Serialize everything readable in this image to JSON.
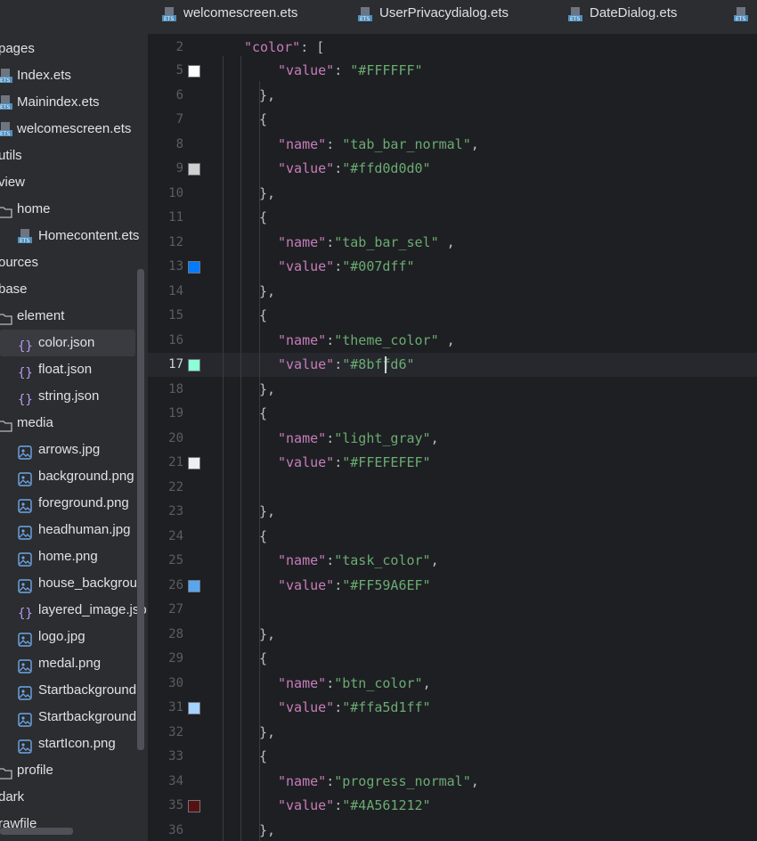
{
  "tabs": [
    {
      "label": "welcomescreen.ets"
    },
    {
      "label": "UserPrivacydialog.ets"
    },
    {
      "label": "DateDialog.ets"
    },
    {
      "label": ""
    }
  ],
  "tree": [
    {
      "label": "pages",
      "icon": "none",
      "indent": 0
    },
    {
      "label": "Index.ets",
      "icon": "ets-file-icon",
      "indent": 0
    },
    {
      "label": "Mainindex.ets",
      "icon": "ets-file-icon",
      "indent": 0
    },
    {
      "label": "welcomescreen.ets",
      "icon": "ets-file-icon",
      "indent": 0
    },
    {
      "label": "utils",
      "icon": "none",
      "indent": 0
    },
    {
      "label": "view",
      "icon": "none",
      "indent": 0
    },
    {
      "label": "home",
      "icon": "folder-icon",
      "indent": 0
    },
    {
      "label": "Homecontent.ets",
      "icon": "ets-file-icon",
      "indent": 1
    },
    {
      "label": "ources",
      "icon": "none",
      "indent": 0
    },
    {
      "label": "base",
      "icon": "none",
      "indent": 0
    },
    {
      "label": "element",
      "icon": "folder-icon",
      "indent": 0
    },
    {
      "label": "color.json",
      "icon": "json-icon",
      "indent": 1,
      "selected": true
    },
    {
      "label": "float.json",
      "icon": "json-icon",
      "indent": 1
    },
    {
      "label": "string.json",
      "icon": "json-icon",
      "indent": 1
    },
    {
      "label": "media",
      "icon": "folder-icon",
      "indent": 0
    },
    {
      "label": "arrows.jpg",
      "icon": "image-icon",
      "indent": 1
    },
    {
      "label": "background.png",
      "icon": "image-icon",
      "indent": 1
    },
    {
      "label": "foreground.png",
      "icon": "image-icon",
      "indent": 1
    },
    {
      "label": "headhuman.jpg",
      "icon": "image-icon",
      "indent": 1
    },
    {
      "label": "home.png",
      "icon": "image-icon",
      "indent": 1
    },
    {
      "label": "house_backgroun",
      "icon": "image-icon",
      "indent": 1
    },
    {
      "label": "layered_image.jso",
      "icon": "json-icon",
      "indent": 1
    },
    {
      "label": "logo.jpg",
      "icon": "image-icon",
      "indent": 1
    },
    {
      "label": "medal.png",
      "icon": "image-icon",
      "indent": 1
    },
    {
      "label": "Startbackground",
      "icon": "image-icon",
      "indent": 1
    },
    {
      "label": "Startbackground",
      "icon": "image-icon",
      "indent": 1
    },
    {
      "label": "startIcon.png",
      "icon": "image-icon",
      "indent": 1
    },
    {
      "label": "profile",
      "icon": "folder-icon",
      "indent": 0
    },
    {
      "label": "dark",
      "icon": "none",
      "indent": 0
    },
    {
      "label": "rawfile",
      "icon": "none",
      "indent": 0
    }
  ],
  "editor": {
    "current_line": "17",
    "lines": [
      {
        "n": "2",
        "text": "\"color\": [",
        "swatch": null,
        "indent": 0
      },
      {
        "n": "5",
        "text": "\"value\": \"#FFFFFF\"",
        "swatch": "#FFFFFF",
        "indent": 2
      },
      {
        "n": "6",
        "text": "},",
        "swatch": null,
        "indent": 1
      },
      {
        "n": "7",
        "text": "{",
        "swatch": null,
        "indent": 1
      },
      {
        "n": "8",
        "text": "\"name\": \"tab_bar_normal\",",
        "swatch": null,
        "indent": 2
      },
      {
        "n": "9",
        "text": "\"value\":\"#ffd0d0d0\"",
        "swatch": "#d0d0d0",
        "indent": 2
      },
      {
        "n": "10",
        "text": "},",
        "swatch": null,
        "indent": 1
      },
      {
        "n": "11",
        "text": "{",
        "swatch": null,
        "indent": 1
      },
      {
        "n": "12",
        "text": "\"name\":\"tab_bar_sel\" ,",
        "swatch": null,
        "indent": 2
      },
      {
        "n": "13",
        "text": "\"value\":\"#007dff\"",
        "swatch": "#007dff",
        "indent": 2
      },
      {
        "n": "14",
        "text": "},",
        "swatch": null,
        "indent": 1
      },
      {
        "n": "15",
        "text": "{",
        "swatch": null,
        "indent": 1
      },
      {
        "n": "16",
        "text": "\"name\":\"theme_color\" ,",
        "swatch": null,
        "indent": 2
      },
      {
        "n": "17",
        "text": "\"value\":\"#8bffd6\"",
        "swatch": "#8bffd6",
        "indent": 2
      },
      {
        "n": "18",
        "text": "},",
        "swatch": null,
        "indent": 1
      },
      {
        "n": "19",
        "text": "{",
        "swatch": null,
        "indent": 1
      },
      {
        "n": "20",
        "text": "\"name\":\"light_gray\",",
        "swatch": null,
        "indent": 2
      },
      {
        "n": "21",
        "text": "\"value\":\"#FFEFEFEF\"",
        "swatch": "#EFEFEF",
        "indent": 2
      },
      {
        "n": "22",
        "text": "",
        "swatch": null,
        "indent": 2
      },
      {
        "n": "23",
        "text": "},",
        "swatch": null,
        "indent": 1
      },
      {
        "n": "24",
        "text": "{",
        "swatch": null,
        "indent": 1
      },
      {
        "n": "25",
        "text": "\"name\":\"task_color\",",
        "swatch": null,
        "indent": 2
      },
      {
        "n": "26",
        "text": "\"value\":\"#FF59A6EF\"",
        "swatch": "#59A6EF",
        "indent": 2
      },
      {
        "n": "27",
        "text": "",
        "swatch": null,
        "indent": 2
      },
      {
        "n": "28",
        "text": "},",
        "swatch": null,
        "indent": 1
      },
      {
        "n": "29",
        "text": "{",
        "swatch": null,
        "indent": 1
      },
      {
        "n": "30",
        "text": "\"name\":\"btn_color\",",
        "swatch": null,
        "indent": 2
      },
      {
        "n": "31",
        "text": "\"value\":\"#ffa5d1ff\"",
        "swatch": "#a5d1ff",
        "indent": 2
      },
      {
        "n": "32",
        "text": "},",
        "swatch": null,
        "indent": 1
      },
      {
        "n": "33",
        "text": "{",
        "swatch": null,
        "indent": 1
      },
      {
        "n": "34",
        "text": "\"name\":\"progress_normal\",",
        "swatch": null,
        "indent": 2
      },
      {
        "n": "35",
        "text": "\"value\":\"#4A561212\"",
        "swatch": "#561212",
        "indent": 2
      },
      {
        "n": "36",
        "text": "},",
        "swatch": null,
        "indent": 1
      }
    ]
  },
  "colors": {
    "key": "#c77dbb",
    "string": "#6aab73",
    "punct": "#bcbec4"
  }
}
